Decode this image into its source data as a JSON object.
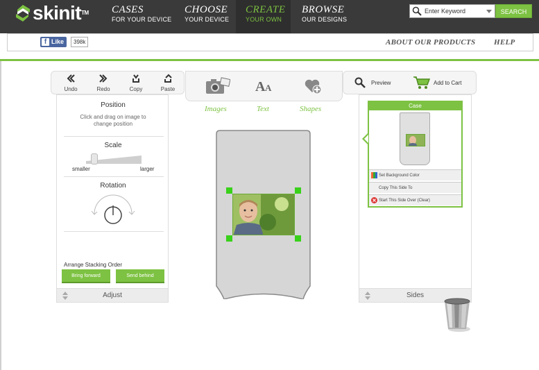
{
  "brand": {
    "name": "skinit",
    "mark": "TM"
  },
  "nav": [
    {
      "big": "CASES",
      "small": "FOR YOUR DEVICE",
      "active": false
    },
    {
      "big": "CHOOSE",
      "small": "YOUR DEVICE",
      "active": false
    },
    {
      "big": "CREATE",
      "small": "YOUR OWN",
      "active": true
    },
    {
      "big": "BROWSE",
      "small": "OUR DESIGNS",
      "active": false
    }
  ],
  "search": {
    "placeholder": "Enter Keyword",
    "button": "SEARCH"
  },
  "social": {
    "like_label": "Like",
    "fb_glyph": "f",
    "count": "398k"
  },
  "sublinks": {
    "about": "ABOUT OUR PRODUCTS",
    "help": "HELP"
  },
  "toolbar": {
    "undo": "Undo",
    "redo": "Redo",
    "copy": "Copy",
    "paste": "Paste"
  },
  "adjust": {
    "position_title": "Position",
    "position_hint": "Click and drag on image to change position",
    "scale_title": "Scale",
    "scale_min": "smaller",
    "scale_max": "larger",
    "scale_value": 0.1,
    "rotation_title": "Rotation",
    "stacking_label": "Arrange Stacking Order",
    "bring_forward": "Bring forward",
    "send_behind": "Send behind",
    "footer": "Adjust"
  },
  "tabs": {
    "images": "Images",
    "text": "Text",
    "shapes": "Shapes"
  },
  "actions": {
    "preview": "Preview",
    "add_to_cart": "Add to Cart"
  },
  "sides": {
    "case_header": "Case",
    "set_bg": "Set Background Color",
    "copy_side": "Copy This Side To",
    "start_over": "Start This Side Over (Clear)",
    "footer": "Sides"
  },
  "colors": {
    "accent": "#7dc242",
    "topbar": "#3a3a3a",
    "handle": "#39d11a",
    "fb": "#4a66a0"
  },
  "icons": [
    "search-icon",
    "undo-icon",
    "redo-icon",
    "copy-icon",
    "paste-icon",
    "images-icon",
    "text-icon",
    "shapes-icon",
    "preview-icon",
    "cart-icon",
    "trash-icon"
  ]
}
